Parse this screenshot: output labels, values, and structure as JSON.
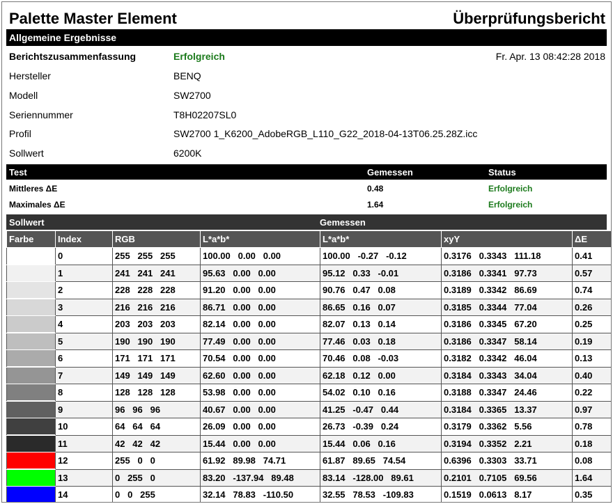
{
  "header": {
    "app_title": "Palette Master Element",
    "report_title": "Überprüfungsbericht"
  },
  "general": {
    "section_title": "Allgemeine Ergebnisse",
    "summary_label": "Berichtszusammenfassung",
    "summary_value": "Erfolgreich",
    "date": "Fr. Apr. 13 08:42:28 2018",
    "fields": [
      {
        "label": "Hersteller",
        "value": "BENQ"
      },
      {
        "label": "Modell",
        "value": "SW2700"
      },
      {
        "label": "Seriennummer",
        "value": "T8H02207SL0"
      },
      {
        "label": "Profil",
        "value": "SW2700 1_K6200_AdobeRGB_L110_G22_2018-04-13T06.25.28Z.icc"
      },
      {
        "label": "Sollwert",
        "value": "6200K"
      }
    ]
  },
  "tests": {
    "headers": {
      "test": "Test",
      "measured": "Gemessen",
      "status": "Status"
    },
    "rows": [
      {
        "name": "Mittleres ΔE",
        "value": "0.48",
        "status": "Erfolgreich"
      },
      {
        "name": "Maximales ΔE",
        "value": "1.64",
        "status": "Erfolgreich"
      }
    ]
  },
  "patches": {
    "group_target": "Sollwert",
    "group_measured": "Gemessen",
    "columns": [
      "Farbe",
      "Index",
      "RGB",
      "L*a*b*",
      "L*a*b*",
      "xyY",
      "ΔE"
    ],
    "rows": [
      {
        "swatch": "#ffffff",
        "index": "0",
        "rgb": "255   255   255",
        "lab_t": "100.00   0.00   0.00",
        "lab_m": "100.00   -0.27   -0.12",
        "xyy": "0.3176   0.3343   111.18",
        "de": "0.41"
      },
      {
        "swatch": "#f1f1f1",
        "index": "1",
        "rgb": "241   241   241",
        "lab_t": "95.63   0.00   0.00",
        "lab_m": "95.12   0.33   -0.01",
        "xyy": "0.3186   0.3341   97.73",
        "de": "0.57"
      },
      {
        "swatch": "#e4e4e4",
        "index": "2",
        "rgb": "228   228   228",
        "lab_t": "91.20   0.00   0.00",
        "lab_m": "90.76   0.47   0.08",
        "xyy": "0.3189   0.3342   86.69",
        "de": "0.74"
      },
      {
        "swatch": "#d8d8d8",
        "index": "3",
        "rgb": "216   216   216",
        "lab_t": "86.71   0.00   0.00",
        "lab_m": "86.65   0.16   0.07",
        "xyy": "0.3185   0.3344   77.04",
        "de": "0.26"
      },
      {
        "swatch": "#cbcbcb",
        "index": "4",
        "rgb": "203   203   203",
        "lab_t": "82.14   0.00   0.00",
        "lab_m": "82.07   0.13   0.14",
        "xyy": "0.3186   0.3345   67.20",
        "de": "0.25"
      },
      {
        "swatch": "#bebebe",
        "index": "5",
        "rgb": "190   190   190",
        "lab_t": "77.49   0.00   0.00",
        "lab_m": "77.46   0.03   0.18",
        "xyy": "0.3186   0.3347   58.14",
        "de": "0.19"
      },
      {
        "swatch": "#ababab",
        "index": "6",
        "rgb": "171   171   171",
        "lab_t": "70.54   0.00   0.00",
        "lab_m": "70.46   0.08   -0.03",
        "xyy": "0.3182   0.3342   46.04",
        "de": "0.13"
      },
      {
        "swatch": "#959595",
        "index": "7",
        "rgb": "149   149   149",
        "lab_t": "62.60   0.00   0.00",
        "lab_m": "62.18   0.12   0.00",
        "xyy": "0.3184   0.3343   34.04",
        "de": "0.40"
      },
      {
        "swatch": "#808080",
        "index": "8",
        "rgb": "128   128   128",
        "lab_t": "53.98   0.00   0.00",
        "lab_m": "54.02   0.10   0.16",
        "xyy": "0.3188   0.3347   24.46",
        "de": "0.22"
      },
      {
        "swatch": "#606060",
        "index": "9",
        "rgb": "96   96   96",
        "lab_t": "40.67   0.00   0.00",
        "lab_m": "41.25   -0.47   0.44",
        "xyy": "0.3184   0.3365   13.37",
        "de": "0.97"
      },
      {
        "swatch": "#404040",
        "index": "10",
        "rgb": "64   64   64",
        "lab_t": "26.09   0.00   0.00",
        "lab_m": "26.73   -0.39   0.24",
        "xyy": "0.3179   0.3362   5.56",
        "de": "0.78"
      },
      {
        "swatch": "#2a2a2a",
        "index": "11",
        "rgb": "42   42   42",
        "lab_t": "15.44   0.00   0.00",
        "lab_m": "15.44   0.06   0.16",
        "xyy": "0.3194   0.3352   2.21",
        "de": "0.18"
      },
      {
        "swatch": "#ff0000",
        "index": "12",
        "rgb": "255   0   0",
        "lab_t": "61.92   89.98   74.71",
        "lab_m": "61.87   89.65   74.54",
        "xyy": "0.6396   0.3303   33.71",
        "de": "0.08"
      },
      {
        "swatch": "#00ff00",
        "index": "13",
        "rgb": "0   255   0",
        "lab_t": "83.20   -137.94   89.48",
        "lab_m": "83.14   -128.00   89.61",
        "xyy": "0.2101   0.7105   69.56",
        "de": "1.64"
      },
      {
        "swatch": "#0000ff",
        "index": "14",
        "rgb": "0   0   255",
        "lab_t": "32.14   78.83   -110.50",
        "lab_m": "32.55   78.53   -109.83",
        "xyy": "0.1519   0.0613   8.17",
        "de": "0.35"
      }
    ]
  }
}
